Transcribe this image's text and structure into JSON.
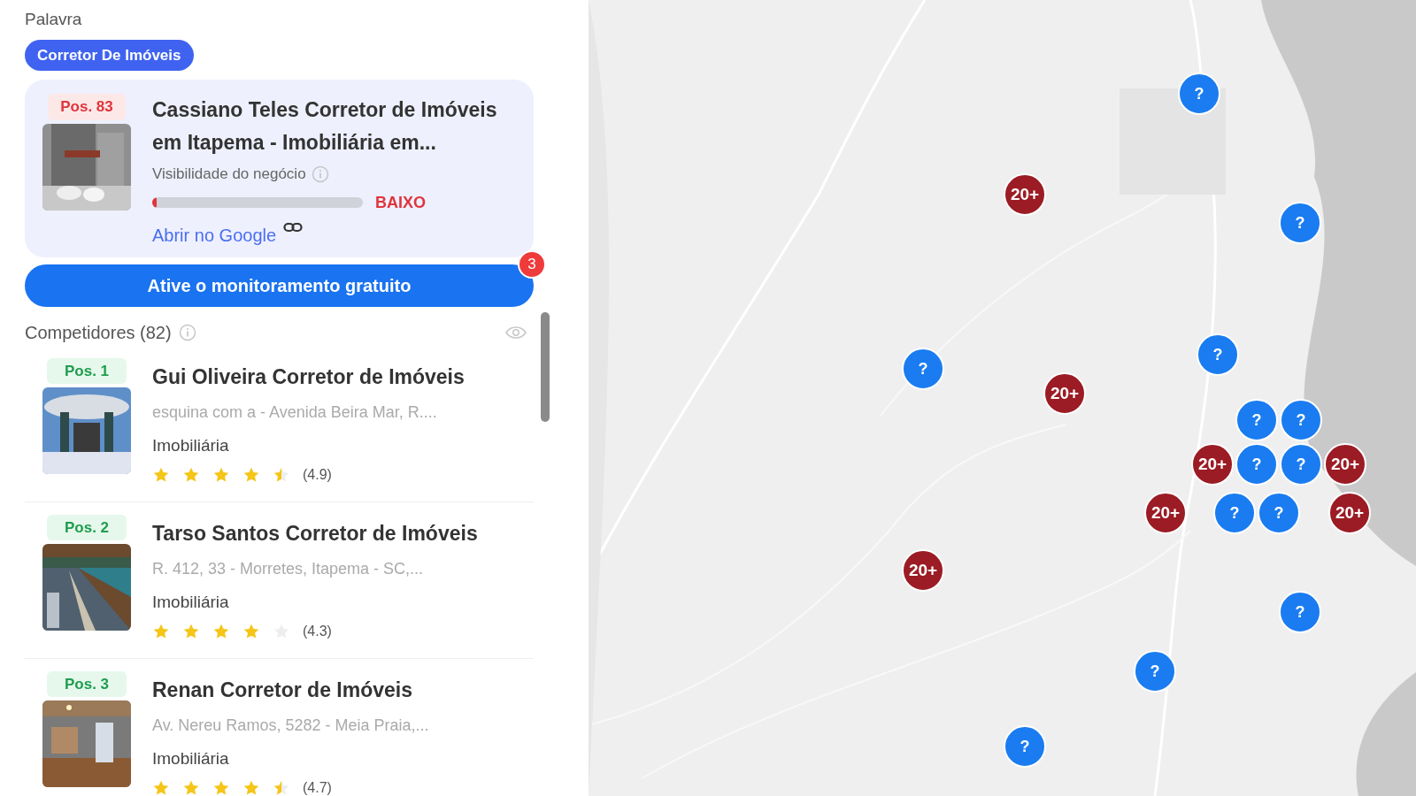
{
  "keyword": {
    "label": "Palavra",
    "chip": "Corretor De Imóveis"
  },
  "business": {
    "position": "Pos. 83",
    "name": "Cassiano Teles Corretor de Imóveis em Itapema - Imobiliária em...",
    "visibility_label": "Visibilidade do negócio",
    "level": 0.02,
    "rating": "BAIXO",
    "link": "Abrir no Google"
  },
  "cta": {
    "label": "Ative o monitoramento gratuito",
    "badge": "3"
  },
  "competitors": {
    "title": "Competidores (82)",
    "items": [
      {
        "position": "Pos. 1",
        "name": "Gui Oliveira Corretor de Imóveis",
        "address": "esquina com a - Avenida Beira Mar, R....",
        "category": "Imobiliária",
        "stars": 4.5,
        "score": "(4.9)"
      },
      {
        "position": "Pos. 2",
        "name": "Tarso Santos Corretor de Imóveis",
        "address": "R. 412, 33 - Morretes, Itapema - SC,...",
        "category": "Imobiliária",
        "stars": 4,
        "score": "(4.3)"
      },
      {
        "position": "Pos. 3",
        "name": "Renan Corretor de Imóveis",
        "address": "Av. Nereu Ramos, 5282 - Meia Praia,...",
        "category": "Imobiliária",
        "stars": 4.5,
        "score": "(4.7)"
      }
    ]
  },
  "map": {
    "markers": [
      {
        "kind": "unknown",
        "label": "?"
      },
      {
        "kind": "cluster",
        "label": "20+"
      },
      {
        "kind": "unknown",
        "label": "?"
      },
      {
        "kind": "unknown",
        "label": "?"
      },
      {
        "kind": "unknown",
        "label": "?"
      },
      {
        "kind": "cluster",
        "label": "20+"
      },
      {
        "kind": "unknown",
        "label": "?"
      },
      {
        "kind": "unknown",
        "label": "?"
      },
      {
        "kind": "cluster",
        "label": "20+"
      },
      {
        "kind": "unknown",
        "label": "?"
      },
      {
        "kind": "unknown",
        "label": "?"
      },
      {
        "kind": "cluster",
        "label": "20+"
      },
      {
        "kind": "cluster",
        "label": "20+"
      },
      {
        "kind": "unknown",
        "label": "?"
      },
      {
        "kind": "unknown",
        "label": "?"
      },
      {
        "kind": "cluster",
        "label": "20+"
      },
      {
        "kind": "cluster",
        "label": "20+"
      },
      {
        "kind": "unknown",
        "label": "?"
      },
      {
        "kind": "unknown",
        "label": "?"
      },
      {
        "kind": "unknown",
        "label": "?"
      }
    ]
  }
}
